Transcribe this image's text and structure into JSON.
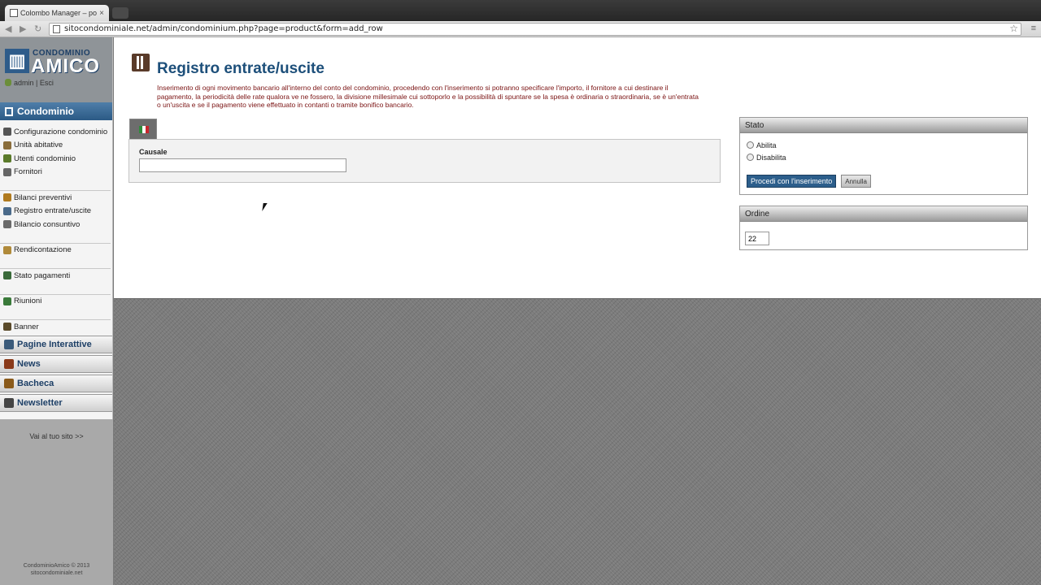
{
  "browser": {
    "tab_title": "Colombo Manager – power",
    "url": "sitocondominiale.net/admin/condominium.php?page=product&form=add_row"
  },
  "sidebar": {
    "logo": {
      "line1": "CONDOMINIO",
      "line2": "AMICO"
    },
    "user": {
      "name": "admin",
      "separator": "|",
      "action": "Esci"
    },
    "section": "Condominio",
    "items": [
      {
        "label": "Configurazione condominio",
        "icon": "gear-icon",
        "color": "#555555"
      },
      {
        "label": "Unità abitative",
        "icon": "home-icon",
        "color": "#8a6d3b"
      },
      {
        "label": "Utenti condominio",
        "icon": "users-icon",
        "color": "#5a7a2a"
      },
      {
        "label": "Fornitori",
        "icon": "tools-icon",
        "color": "#666666"
      },
      {
        "label": "Bilanci preventivi",
        "icon": "chart-icon",
        "color": "#b07a1e"
      },
      {
        "label": "Registro entrate/uscite",
        "icon": "ledger-icon",
        "color": "#4a6a8a"
      },
      {
        "label": "Bilancio consuntivo",
        "icon": "report-icon",
        "color": "#6a6a6a"
      },
      {
        "label": "Rendicontazione",
        "icon": "scale-icon",
        "color": "#b08a3a"
      },
      {
        "label": "Stato pagamenti",
        "icon": "payments-icon",
        "color": "#3a6a3a"
      },
      {
        "label": "Riunioni",
        "icon": "meeting-icon",
        "color": "#3a7a3a"
      },
      {
        "label": "Banner",
        "icon": "banner-icon",
        "color": "#5a4a2a"
      }
    ],
    "collapsed": [
      {
        "label": "Pagine Interattive",
        "icon": "pages-icon",
        "color": "#3a5a7a"
      },
      {
        "label": "News",
        "icon": "news-icon",
        "color": "#8a3a1a"
      },
      {
        "label": "Bacheca",
        "icon": "board-icon",
        "color": "#8a5a1a"
      },
      {
        "label": "Newsletter",
        "icon": "newsletter-icon",
        "color": "#444444"
      }
    ],
    "visit_link": "Vai al tuo sito >>",
    "footer": {
      "line1": "CondominioAmico © 2013",
      "line2": "sitocondominiale.net"
    }
  },
  "page": {
    "title": "Registro entrate/uscite",
    "description": "Inserimento di ogni movimento bancario all'interno del conto del condominio, procedendo con l'inserimento si potranno specificare l'importo, il fornitore a cui destinare il pagamento, la periodicità delle rate qualora ve ne fossero, la divisione millesimale cui sottoporlo e la possibilità di spuntare se la spesa è ordinaria o straordinaria, se è un'entrata o un'uscita e se il pagamento viene effettuato in contanti o tramite bonifico bancario."
  },
  "form": {
    "causale_label": "Causale",
    "causale_value": ""
  },
  "stato": {
    "title": "Stato",
    "options": [
      "Abilita",
      "Disabilita"
    ],
    "submit": "Procedi con l'inserimento",
    "cancel": "Annulla"
  },
  "ordine": {
    "title": "Ordine",
    "value": "22"
  }
}
